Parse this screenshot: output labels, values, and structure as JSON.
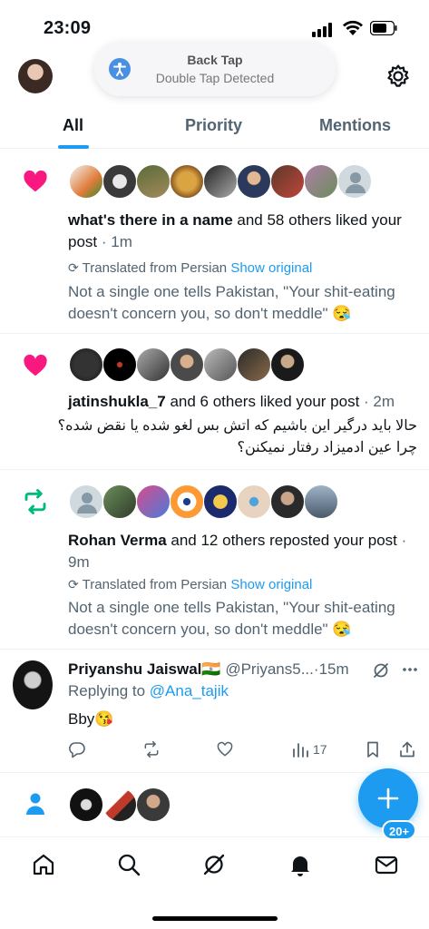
{
  "status_bar": {
    "time": "23:09"
  },
  "banner": {
    "title": "Back Tap",
    "subtitle": "Double Tap Detected"
  },
  "tabs": [
    {
      "label": "All"
    },
    {
      "label": "Priority"
    },
    {
      "label": "Mentions"
    }
  ],
  "notifications": [
    {
      "type": "like",
      "name": "what's there in a name",
      "action": "and 58 others liked your post",
      "time": "1m",
      "translated": "Translated from Persian",
      "show_original": "Show original",
      "text": "Not a single one tells Pakistan, \"Your shit-eating doesn't concern you, so don't meddle\" 😪"
    },
    {
      "type": "like",
      "name": "jatinshukla_7",
      "action": "and 6 others liked your post",
      "time": "2m",
      "text": "حالا باید درگیر این باشیم که اتش بس لغو شده یا نقض شده؟چرا عین ادمیزاد رفتار نمیکنن؟"
    },
    {
      "type": "repost",
      "name": "Rohan Verma",
      "action": "and 12 others reposted your post",
      "time": "9m",
      "translated": "Translated from Persian",
      "show_original": "Show original",
      "text": "Not a single one tells Pakistan, \"Your shit-eating doesn't concern you, so don't meddle\" 😪"
    }
  ],
  "tweet": {
    "name": "Priyanshu Jaiswal🇮🇳",
    "handle": "@Priyans5...",
    "time": "15m",
    "replying_to_label": "Replying to",
    "replying_to_user": "@Ana_tajik",
    "text": "Bby😘",
    "views": "17"
  },
  "tabbar": {
    "messages_badge": "20+"
  },
  "colors": {
    "accent": "#1d9bf0",
    "like": "#f91880",
    "repost": "#00ba7c"
  },
  "icons": [
    "home-icon",
    "search-icon",
    "grok-icon",
    "bell-icon",
    "mail-icon",
    "gear-icon",
    "heart-icon",
    "repost-icon",
    "person-icon",
    "compose-icon"
  ]
}
